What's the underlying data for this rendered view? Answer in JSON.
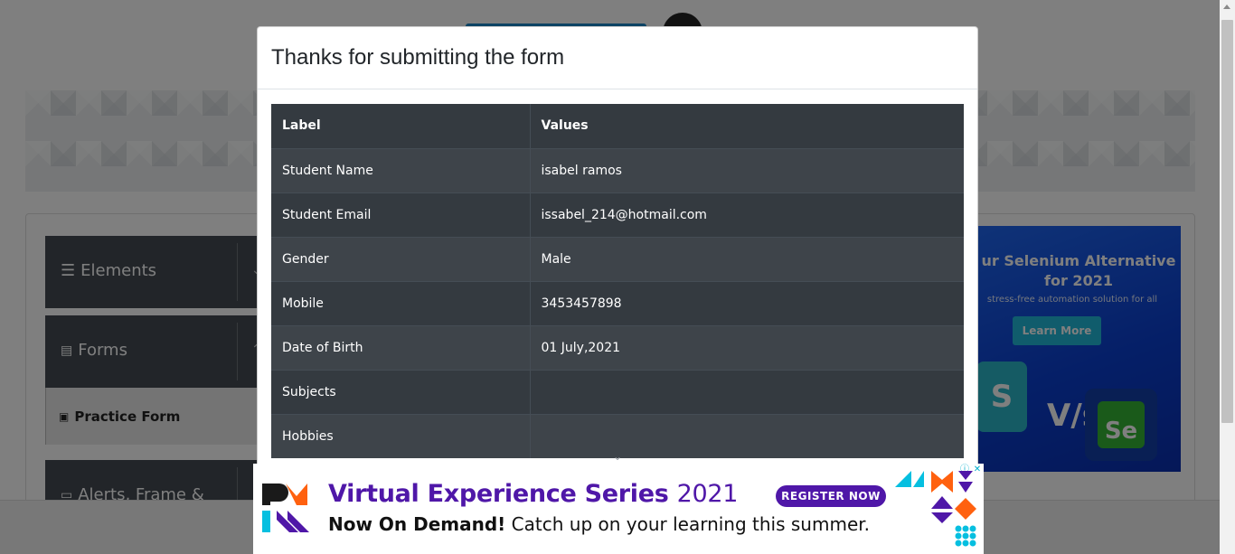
{
  "sidebar": {
    "groups": [
      {
        "label": "Elements"
      },
      {
        "label": "Forms"
      },
      {
        "label": "Alerts, Frame &"
      }
    ],
    "active_item": "Practice Form"
  },
  "right_ad": {
    "title": "ur Selenium Alternative for 2021",
    "subtitle": "stress-free automation solution for all",
    "button": "Learn More",
    "vs": "V/s",
    "se": "Se"
  },
  "modal": {
    "title": "Thanks for submitting the form",
    "table": {
      "headers": [
        "Label",
        "Values"
      ],
      "rows": [
        {
          "label": "Student Name",
          "value": "isabel ramos"
        },
        {
          "label": "Student Email",
          "value": "issabel_214@hotmail.com"
        },
        {
          "label": "Gender",
          "value": "Male"
        },
        {
          "label": "Mobile",
          "value": "3453457898"
        },
        {
          "label": "Date of Birth",
          "value": "01 July,2021"
        },
        {
          "label": "Subjects",
          "value": ""
        },
        {
          "label": "Hobbies",
          "value": ""
        }
      ]
    }
  },
  "bottom_ad": {
    "headline_main": "Virtual Experience Series",
    "headline_year": "2021",
    "register": "REGISTER NOW",
    "line2_bold": "Now On Demand!",
    "line2_rest": "Catch up on your learning this summer.",
    "info_icon": "info-icon",
    "close_icon": "close-icon"
  },
  "colors": {
    "table_dark": "#343a40",
    "table_striped": "#3e444a",
    "ad_purple": "#4f17a8",
    "sidebar": "#444b53"
  }
}
